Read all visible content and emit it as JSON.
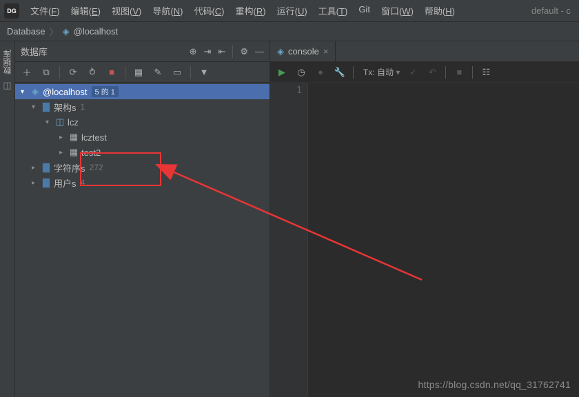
{
  "app": {
    "icon_text": "DG",
    "right_status": "default - c"
  },
  "menu": [
    {
      "label": "文件",
      "key": "F"
    },
    {
      "label": "编辑",
      "key": "E"
    },
    {
      "label": "视图",
      "key": "V"
    },
    {
      "label": "导航",
      "key": "N"
    },
    {
      "label": "代码",
      "key": "C"
    },
    {
      "label": "重构",
      "key": "R"
    },
    {
      "label": "运行",
      "key": "U"
    },
    {
      "label": "工具",
      "key": "T"
    },
    {
      "label": "Git",
      "key": ""
    },
    {
      "label": "窗口",
      "key": "W"
    },
    {
      "label": "帮助",
      "key": "H"
    }
  ],
  "breadcrumb": {
    "first": "Database",
    "second": "@localhost"
  },
  "sidebar_vertical": {
    "label": "数据库"
  },
  "panel": {
    "title": "数据库",
    "header_icons": [
      "target-icon",
      "collapse-icon",
      "expand-icon",
      "gear-icon",
      "hide-icon"
    ],
    "toolbar_icons": [
      "plus-icon",
      "copy-icon",
      "refresh-icon",
      "sync-icon",
      "stop-icon",
      "table-view-icon",
      "edit-icon",
      "query-icon",
      "filter-icon"
    ]
  },
  "tree": {
    "root": {
      "label": "@localhost",
      "badge": "5 的 1"
    },
    "schema": {
      "label": "架构s",
      "count": "1"
    },
    "lcz": {
      "label": "lcz"
    },
    "tables": [
      {
        "label": "lcztest"
      },
      {
        "label": "test2"
      }
    ],
    "charset": {
      "label": "字符序s",
      "count": "272"
    },
    "users": {
      "label": "用户s",
      "count": "4"
    }
  },
  "editor": {
    "tab": {
      "label": "console"
    },
    "toolbar": {
      "tx_label": "Tx: 自动"
    },
    "gutter": {
      "line1": "1"
    }
  },
  "watermark": "https://blog.csdn.net/qq_31762741"
}
